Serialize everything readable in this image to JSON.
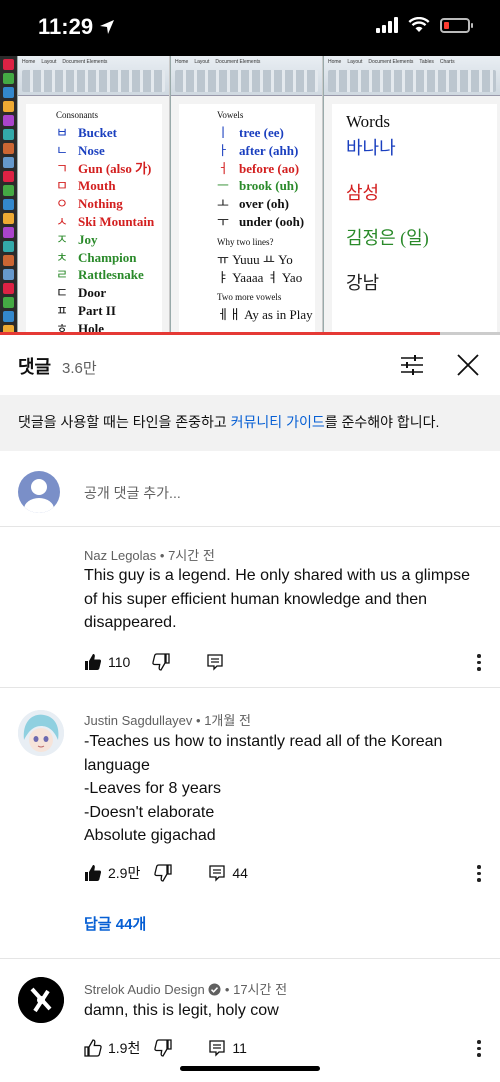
{
  "status_bar": {
    "time": "11:29"
  },
  "video": {
    "consonants": {
      "heading": "Consonants",
      "rows": [
        {
          "glyph": "ㅂ",
          "word": "Bucket",
          "color": "#1a3fbf"
        },
        {
          "glyph": "ㄴ",
          "word": "Nose",
          "color": "#1a3fbf"
        },
        {
          "glyph": "ㄱ",
          "word": "Gun (also 가)",
          "color": "#d32020"
        },
        {
          "glyph": "ㅁ",
          "word": "Mouth",
          "color": "#d32020"
        },
        {
          "glyph": "ㅇ",
          "word": "Nothing",
          "color": "#d32020"
        },
        {
          "glyph": "ㅅ",
          "word": "Ski Mountain",
          "color": "#d32020"
        },
        {
          "glyph": "ㅈ",
          "word": "Joy",
          "color": "#2a8a2a"
        },
        {
          "glyph": "ㅊ",
          "word": "Champion",
          "color": "#2a8a2a"
        },
        {
          "glyph": "ㄹ",
          "word": "Rattlesnake",
          "color": "#2a8a2a"
        },
        {
          "glyph": "ㄷ",
          "word": "Door",
          "color": "#111111"
        },
        {
          "glyph": "ㅍ",
          "word": "Part II",
          "color": "#111111"
        },
        {
          "glyph": "ㅎ",
          "word": "Hole",
          "color": "#111111"
        }
      ]
    },
    "vowels": {
      "heading": "Vowels",
      "rows": [
        {
          "glyph": "ㅣ",
          "word": "tree  (ee)",
          "color": "#1a3fbf"
        },
        {
          "glyph": "ㅏ",
          "word": "after (ahh)",
          "color": "#1a3fbf"
        },
        {
          "glyph": "ㅓ",
          "word": "before  (ao)",
          "color": "#d32020"
        },
        {
          "glyph": "ㅡ",
          "word": "brook  (uh)",
          "color": "#2a8a2a"
        },
        {
          "glyph": "ㅗ",
          "word": "over  (oh)",
          "color": "#111111"
        },
        {
          "glyph": "ㅜ",
          "word": "under  (ooh)",
          "color": "#111111"
        }
      ],
      "why_heading": "Why two lines?",
      "why_rows": [
        "ㅠ Yuuu  ㅛ  Yo",
        "ㅑ Yaaaa ㅕ Yao"
      ],
      "more_heading": "Two more vowels",
      "more_row": "ㅔㅐ Ay as in Play"
    },
    "words": {
      "heading": "Words",
      "items": [
        {
          "text": "바나나",
          "color": "#1a3fbf"
        },
        {
          "text": "삼성",
          "color": "#d32020"
        },
        {
          "text": "김정은 (일)",
          "color": "#2a8a2a"
        },
        {
          "text": "강남",
          "color": "#222222"
        }
      ]
    },
    "progress_fraction": 0.88
  },
  "comments_panel": {
    "title": "댓글",
    "count": "3.6만",
    "guideline_before": "댓글을 사용할 때는 타인을 존중하고 ",
    "guideline_link": "커뮤니티 가이드",
    "guideline_after": "를 준수해야 합니다.",
    "add_placeholder": "공개 댓글 추가..."
  },
  "comments": [
    {
      "author": "Naz Legolas",
      "time": "7시간 전",
      "lines": [
        "This guy is a legend. He only shared with us a glimpse",
        "of his super efficient human knowledge and then",
        "disappeared."
      ],
      "likes": "110",
      "replies_count": ""
    },
    {
      "author": "Justin Sagdullayev",
      "time": "1개월 전",
      "lines": [
        "-Teaches us how to instantly read all of the Korean",
        "language",
        "-Leaves for 8 years",
        "-Doesn't elaborate",
        "Absolute gigachad"
      ],
      "likes": "2.9만",
      "replies_count": "44",
      "replies_link": "답글 44개"
    },
    {
      "author": "Strelok Audio Design",
      "time": "17시간 전",
      "lines": [
        "damn, this is legit, holy cow"
      ],
      "likes": "1.9천",
      "replies_count": "11"
    }
  ]
}
